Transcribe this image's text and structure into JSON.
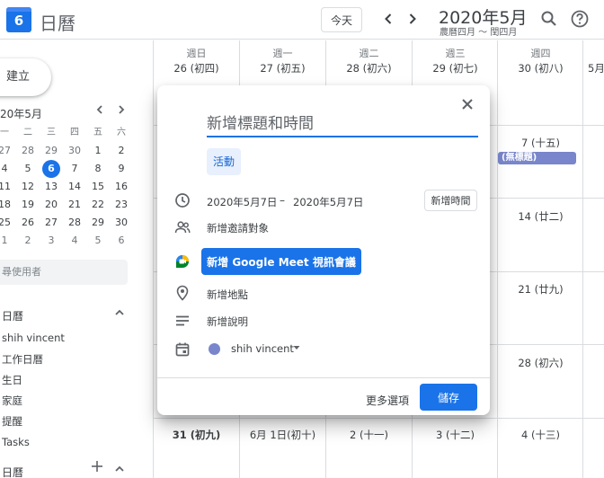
{
  "header": {
    "logo_day": "6",
    "app_name": "日曆",
    "today_label": "今天",
    "prev_icon": "chevron-left-icon",
    "next_icon": "chevron-right-icon",
    "month_title": "2020年5月",
    "lunar_subtitle": "農曆四月 ～ 閏四月",
    "search_icon": "search-icon",
    "help_icon": "help-icon"
  },
  "sidebar": {
    "create_label": "建立",
    "mini_month": "20年5月",
    "weekday_heads": [
      "一",
      "二",
      "三",
      "四",
      "五",
      "六"
    ],
    "weeks": [
      [
        "27",
        "28",
        "29",
        "30",
        "1",
        "2"
      ],
      [
        "4",
        "5",
        "6",
        "7",
        "8",
        "9"
      ],
      [
        "11",
        "12",
        "13",
        "14",
        "15",
        "16"
      ],
      [
        "18",
        "19",
        "20",
        "21",
        "22",
        "23"
      ],
      [
        "25",
        "26",
        "27",
        "28",
        "29",
        "30"
      ],
      [
        "1",
        "2",
        "3",
        "4",
        "5",
        "6"
      ]
    ],
    "today_value": "6",
    "search_people_placeholder": "尋使用者",
    "my_calendars_title": "日曆",
    "my_calendars": [
      "shih vincent",
      "工作日曆",
      "生日",
      "家庭",
      "提醒",
      "Tasks"
    ],
    "other_calendars_title": "日曆"
  },
  "calendar": {
    "days": [
      {
        "weekday": "週日",
        "date": "26 (初四)"
      },
      {
        "weekday": "週一",
        "date": "27 (初五)"
      },
      {
        "weekday": "週二",
        "date": "28 (初六)"
      },
      {
        "weekday": "週三",
        "date": "29 (初七)"
      },
      {
        "weekday": "週四",
        "date": "30 (初八)"
      },
      {
        "weekday": "",
        "date": "5月"
      }
    ],
    "thursday_dates": [
      "7 (十五)",
      "14 (廿二)",
      "21 (廿九)",
      "28 (初六)"
    ],
    "last_row_dates": [
      "31 (初九)",
      "6月 1日(初十)",
      "2 (十一)",
      "3 (十二)",
      "4 (十三)"
    ],
    "event_chip": "(無標題)",
    "event_color": "#7986cb"
  },
  "dialog": {
    "title_placeholder": "新增標題和時間",
    "type_label": "活動",
    "start_date": "2020年5月7日",
    "separator": "–",
    "end_date": "2020年5月7日",
    "add_time_label": "新增時間",
    "guests_label": "新增邀請對象",
    "meet_label": "新增 Google Meet 視訊會議",
    "location_label": "新增地點",
    "description_label": "新增說明",
    "owner_name": "shih vincent",
    "owner_color": "#7986cb",
    "more_options_label": "更多選項",
    "save_label": "儲存"
  }
}
